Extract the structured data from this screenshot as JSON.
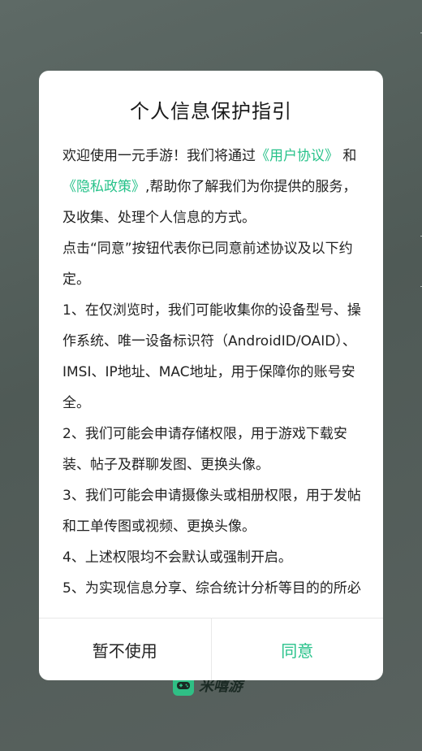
{
  "dialog": {
    "title": "个人信息保护指引",
    "p1": {
      "t1": "欢迎使用一元手游！我们将通过",
      "link1": "《用户协议》",
      "t2": "和",
      "link2": "《隐私政策》",
      "t3": ",帮助你了解我们为你提供的服务，及收集、处理个人信息的方式。"
    },
    "p2": "点击“同意”按钮代表你已同意前述协议及以下约定。",
    "p3": "1、在仅浏览时，我们可能收集你的设备型号、操作系统、唯一设备标识符（AndroidID/OAID）、IMSI、IP地址、MAC地址，用于保障你的账号安全。",
    "p4": "2、我们可能会申请存储权限，用于游戏下载安装、帖子及群聊发图、更换头像。",
    "p5": "3、我们可能会申请摄像头或相册权限，用于发帖和工单传图或视频、更换头像。",
    "p6": "4、上述权限均不会默认或强制开启。",
    "p7": "5、为实现信息分享、综合统计分析等目的的所必",
    "cancel_label": "暂不使用",
    "agree_label": "同意"
  },
  "brand": {
    "name": "米嘻游"
  },
  "colors": {
    "accent": "#27c28a",
    "overlay": "#566360"
  }
}
